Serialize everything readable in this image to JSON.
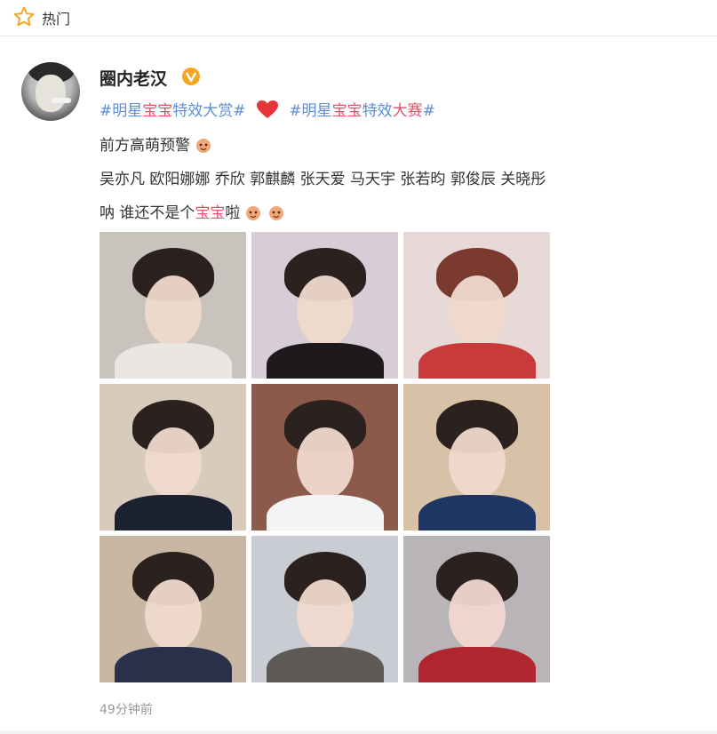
{
  "header": {
    "title": "热门",
    "icon": "star-outline-icon",
    "icon_color": "#f5a623"
  },
  "post": {
    "author": "圈内老汉",
    "verified_badge": "V",
    "hashtag1": {
      "prefix": "#明星",
      "highlight": "宝宝",
      "suffix": "特效大赏#"
    },
    "hashtag2": {
      "prefix": "#明星",
      "highlight": "宝宝",
      "mid": "特效",
      "highlight2": "大赛",
      "suffix": "#"
    },
    "line2": "前方高萌预警",
    "line3": "吴亦凡 欧阳娜娜 乔欣 郭麒麟 张天爱 马天宇 张若昀 郭俊辰 关晓彤",
    "line4_prefix": "呐 谁还不是个",
    "line4_keyword": "宝宝",
    "line4_suffix": "啦",
    "timestamp": "49分钟前"
  },
  "colors": {
    "hashtag": "#5b8ed6",
    "keyword": "#e0536b",
    "heart": "#e8343b",
    "verified": "#f5a623"
  },
  "images": [
    {
      "name": "photo-1",
      "bg": "#c9c3bd"
    },
    {
      "name": "photo-2",
      "bg": "#d8ccd6"
    },
    {
      "name": "photo-3",
      "bg": "#e6d9d7"
    },
    {
      "name": "photo-4",
      "bg": "#d9cbbb"
    },
    {
      "name": "photo-5",
      "bg": "#8c5a4a"
    },
    {
      "name": "photo-6",
      "bg": "#d7c2a7"
    },
    {
      "name": "photo-7",
      "bg": "#c8b7a3"
    },
    {
      "name": "photo-8",
      "bg": "#c9cdd3"
    },
    {
      "name": "photo-9",
      "bg": "#b8b4b8"
    }
  ]
}
